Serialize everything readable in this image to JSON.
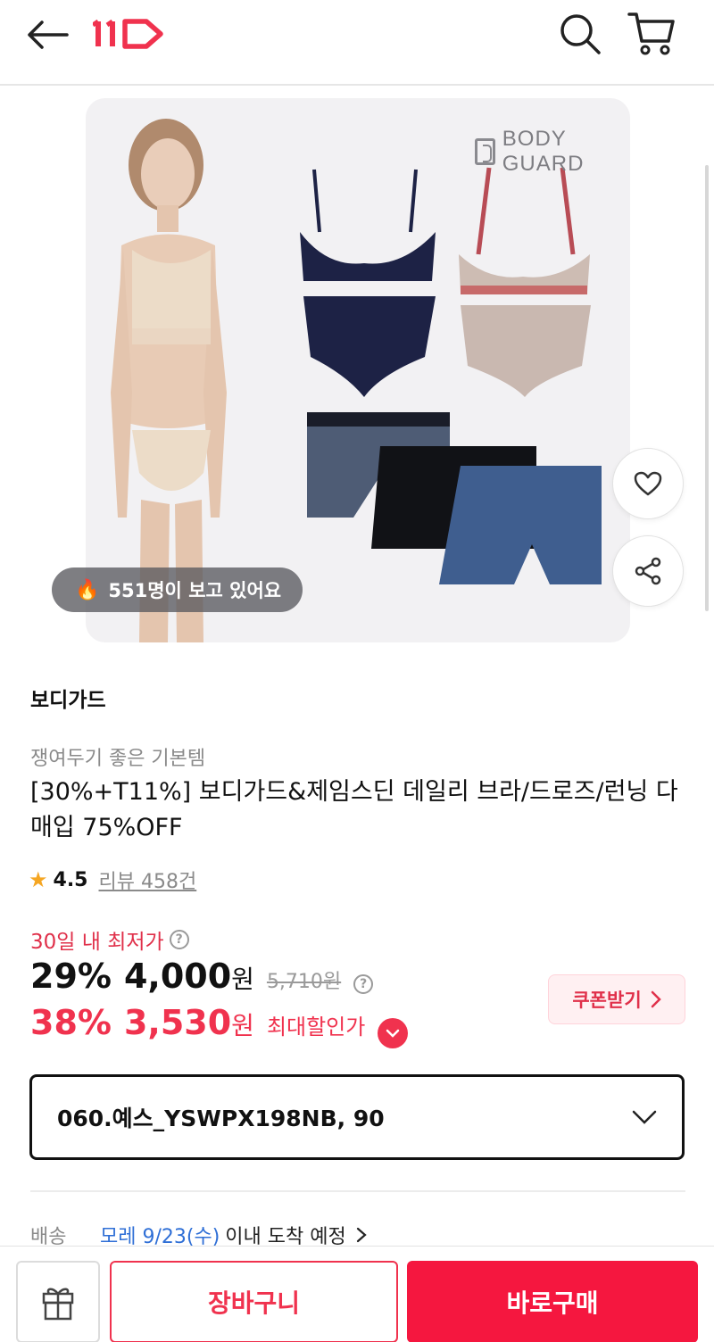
{
  "header": {
    "logo_text": "11",
    "logo_color": "#f0324e"
  },
  "image": {
    "brand_watermark": "BODY GUARD",
    "viewers_badge": "551명이 보고 있어요"
  },
  "product": {
    "brand": "보디가드",
    "subtitle": "쟁여두기 좋은 기본템",
    "title": "[30%+T11%] 보디가드&제임스딘 데일리 브라/드로즈/런닝 다매입 75%OFF",
    "rating": "4.5",
    "review_text": "리뷰 458건"
  },
  "pricing": {
    "lowest_label": "30일 내 최저가",
    "rate1": "29%",
    "price1": "4,000",
    "won": "원",
    "original_price": "5,710원",
    "rate2": "38%",
    "price2": "3,530",
    "max_discount_label": "최대할인가",
    "coupon_button": "쿠폰받기"
  },
  "option": {
    "selected": "060.예스_YSWPX198NB, 90"
  },
  "shipping": {
    "label": "배송",
    "date": "모레 9/23(수)",
    "rest": "이내 도착 예정"
  },
  "bottom_bar": {
    "cart_button": "장바구니",
    "buy_button": "바로구매"
  },
  "colors": {
    "accent": "#f0324e",
    "link_blue": "#2f6fd6"
  }
}
